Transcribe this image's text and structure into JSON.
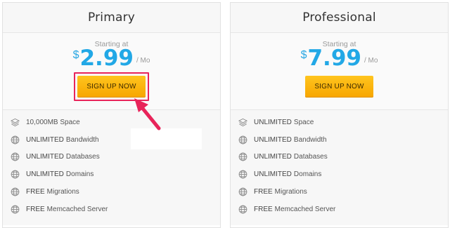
{
  "plans": [
    {
      "title": "Primary",
      "starting_label": "Starting at",
      "currency": "$",
      "price": "2.99",
      "per": "/ Mo",
      "cta": "SIGN UP NOW",
      "features": [
        {
          "icon": "layers-icon",
          "strong": "",
          "text": "10,000MB Space"
        },
        {
          "icon": "globe-icon",
          "strong": "UNLIMITED",
          "text": "Bandwidth"
        },
        {
          "icon": "globe-icon",
          "strong": "UNLIMITED",
          "text": "Databases"
        },
        {
          "icon": "globe-icon",
          "strong": "UNLIMITED",
          "text": "Domains"
        },
        {
          "icon": "globe-icon",
          "strong": "FREE",
          "text": "Migrations"
        },
        {
          "icon": "globe-icon",
          "strong": "FREE",
          "text": "Memcached Server"
        }
      ]
    },
    {
      "title": "Professional",
      "starting_label": "Starting at",
      "currency": "$",
      "price": "7.99",
      "per": "/ Mo",
      "cta": "SIGN UP NOW",
      "features": [
        {
          "icon": "layers-icon",
          "strong": "UNLIMITED",
          "text": "Space"
        },
        {
          "icon": "globe-icon",
          "strong": "UNLIMITED",
          "text": "Bandwidth"
        },
        {
          "icon": "globe-icon",
          "strong": "UNLIMITED",
          "text": "Databases"
        },
        {
          "icon": "globe-icon",
          "strong": "UNLIMITED",
          "text": "Domains"
        },
        {
          "icon": "globe-icon",
          "strong": "FREE",
          "text": "Migrations"
        },
        {
          "icon": "globe-icon",
          "strong": "FREE",
          "text": "Memcached Server"
        }
      ]
    }
  ],
  "annotation": {
    "icon": "pointer-arrow-icon",
    "color": "#e8245a"
  },
  "colors": {
    "price": "#22a8e6",
    "button": "#f7a600",
    "highlight": "#e8245a"
  }
}
